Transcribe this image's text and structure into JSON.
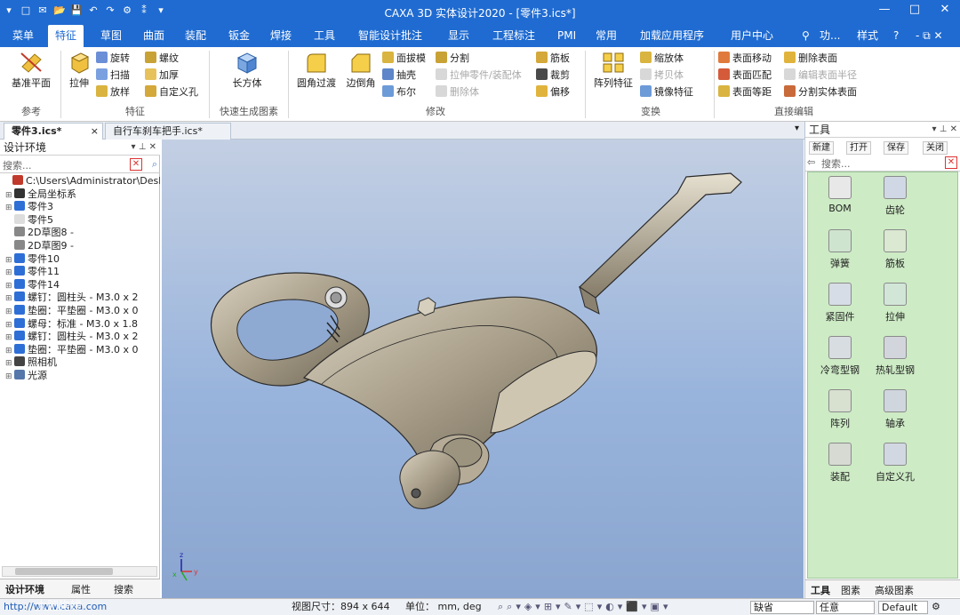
{
  "window": {
    "title": "CAXA 3D 实体设计2020 - [零件3.ics*]"
  },
  "qat": [
    "▾",
    "□",
    "✉",
    "📂",
    "💾",
    "↶",
    "↷",
    "⚙",
    "⁑",
    "▾"
  ],
  "winctl": {
    "min": "—",
    "max": "□",
    "close": "✕"
  },
  "menu": {
    "tabs": [
      "菜单",
      "特征",
      "草图",
      "曲面",
      "装配",
      "钣金",
      "焊接",
      "工具",
      "智能设计批注",
      "显示",
      "工程标注",
      "PMI",
      "常用",
      "加载应用程序",
      "用户中心"
    ],
    "active": "特征",
    "search": "功...",
    "style": "样式",
    "help": "?"
  },
  "ribbon": {
    "ref": {
      "big": "基准平面",
      "label": "参考"
    },
    "feature": {
      "big": "拉伸",
      "small": [
        "旋转",
        "扫描",
        "放样",
        "螺纹",
        "加厚",
        "自定义孔"
      ],
      "label": "特征"
    },
    "quick": {
      "big": "长方体",
      "label": "快速生成图素"
    },
    "modify": {
      "big1": "圆角过渡",
      "big2": "边倒角",
      "small": [
        "面拔模",
        "抽壳",
        "布尔",
        "分割",
        "拉伸零件/装配体",
        "删除体",
        "筋板",
        "裁剪",
        "偏移"
      ],
      "label": "修改"
    },
    "transform": {
      "big": "阵列特征",
      "small": [
        "缩放体",
        "拷贝体",
        "镜像特征"
      ],
      "label": "变换"
    },
    "direct": {
      "small": [
        "表面移动",
        "表面匹配",
        "表面等距",
        "删除表面",
        "编辑表面半径",
        "分割实体表面"
      ],
      "label": "直接编辑"
    }
  },
  "doctabs": [
    "零件3.ics*",
    "自行车刹车把手.ics*"
  ],
  "left": {
    "title": "设计环境",
    "search_placeholder": "搜索...",
    "tree": [
      {
        "label": "C:\\Users\\Administrator\\Desktop\\",
        "icon": "root-icon",
        "color": "#c0392b",
        "exp": ""
      },
      {
        "label": "全局坐标系",
        "icon": "axis-icon",
        "color": "#333333",
        "exp": "⊞"
      },
      {
        "label": "零件3",
        "icon": "part-icon",
        "color": "#2e6fd6",
        "exp": "⊞"
      },
      {
        "label": "零件5",
        "icon": "part-outline-icon",
        "color": "#dddddd",
        "exp": ""
      },
      {
        "label": "2D草图8 -",
        "icon": "sketch-icon",
        "color": "#888888",
        "exp": ""
      },
      {
        "label": "2D草图9 -",
        "icon": "sketch-icon",
        "color": "#888888",
        "exp": ""
      },
      {
        "label": "零件10",
        "icon": "part-icon",
        "color": "#2e6fd6",
        "exp": "⊞"
      },
      {
        "label": "零件11",
        "icon": "part-icon",
        "color": "#2e6fd6",
        "exp": "⊞"
      },
      {
        "label": "零件14",
        "icon": "part-icon",
        "color": "#2e6fd6",
        "exp": "⊞"
      },
      {
        "label": "螺钉：圆柱头 - M3.0 x 2",
        "icon": "part-icon",
        "color": "#2e6fd6",
        "exp": "⊞"
      },
      {
        "label": "垫圈：平垫圈 - M3.0 x 0",
        "icon": "part-icon",
        "color": "#2e6fd6",
        "exp": "⊞"
      },
      {
        "label": "螺母：标准 - M3.0 x 1.8",
        "icon": "part-icon",
        "color": "#2e6fd6",
        "exp": "⊞"
      },
      {
        "label": "螺钉：圆柱头 - M3.0 x 2",
        "icon": "part-icon",
        "color": "#2e6fd6",
        "exp": "⊞"
      },
      {
        "label": "垫圈：平垫圈 - M3.0 x 0",
        "icon": "part-icon",
        "color": "#2e6fd6",
        "exp": "⊞"
      },
      {
        "label": "照相机",
        "icon": "camera-icon",
        "color": "#444444",
        "exp": "⊞"
      },
      {
        "label": "光源",
        "icon": "light-icon",
        "color": "#5577aa",
        "exp": "⊞"
      }
    ],
    "bottom_tabs": [
      "设计环境",
      "属性",
      "搜索"
    ]
  },
  "right": {
    "title": "工具",
    "toolbar": [
      "新建",
      "打开",
      "保存",
      "关闭"
    ],
    "search_placeholder": "搜索...",
    "items": [
      "BOM",
      "齿轮",
      "弹簧",
      "筋板",
      "紧固件",
      "拉伸",
      "冷弯型钢",
      "热轧型钢",
      "阵列",
      "轴承",
      "装配",
      "自定义孔"
    ],
    "bottom_tabs": [
      "工具",
      "图素",
      "高级图素"
    ]
  },
  "status": {
    "url": "http://www.caxa.com",
    "viewsize": "视图尺寸：894 x 644",
    "units": "单位：  mm, deg",
    "field1": "缺省",
    "field2": "任意",
    "field3": "Default"
  },
  "watermark": "大肥狗镜"
}
